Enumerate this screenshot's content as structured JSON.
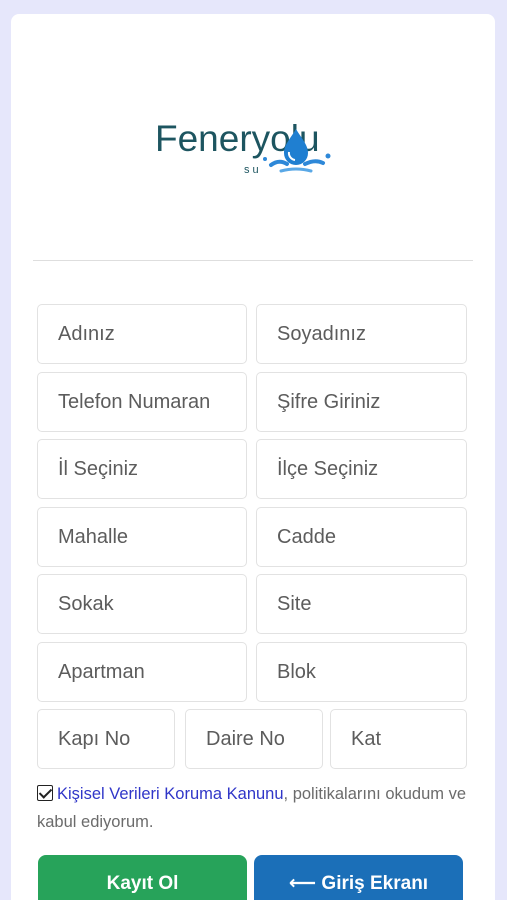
{
  "brand": {
    "name": "Feneryolu",
    "sub": "su",
    "text_color": "#1d5560",
    "drop_color": "#1f7fd1"
  },
  "form": {
    "first_name": "Adınız",
    "last_name": "Soyadınız",
    "phone": "Telefon Numaran",
    "password": "Şifre Giriniz",
    "province": "İl Seçiniz",
    "district": "İlçe Seçiniz",
    "neighborhood": "Mahalle",
    "avenue": "Cadde",
    "street": "Sokak",
    "site": "Site",
    "apartment": "Apartman",
    "block": "Blok",
    "door_no": "Kapı No",
    "flat_no": "Daire No",
    "floor": "Kat"
  },
  "consent": {
    "checked": true,
    "link_text": "Kişisel Verileri Koruma Kanunu",
    "rest_text": ", politikalarını okudum ve kabul ediyorum."
  },
  "buttons": {
    "register": "Kayıt Ol",
    "login": "⟵ Giriş Ekranı",
    "register_color": "#27a35a",
    "login_color": "#1b6fb8"
  }
}
